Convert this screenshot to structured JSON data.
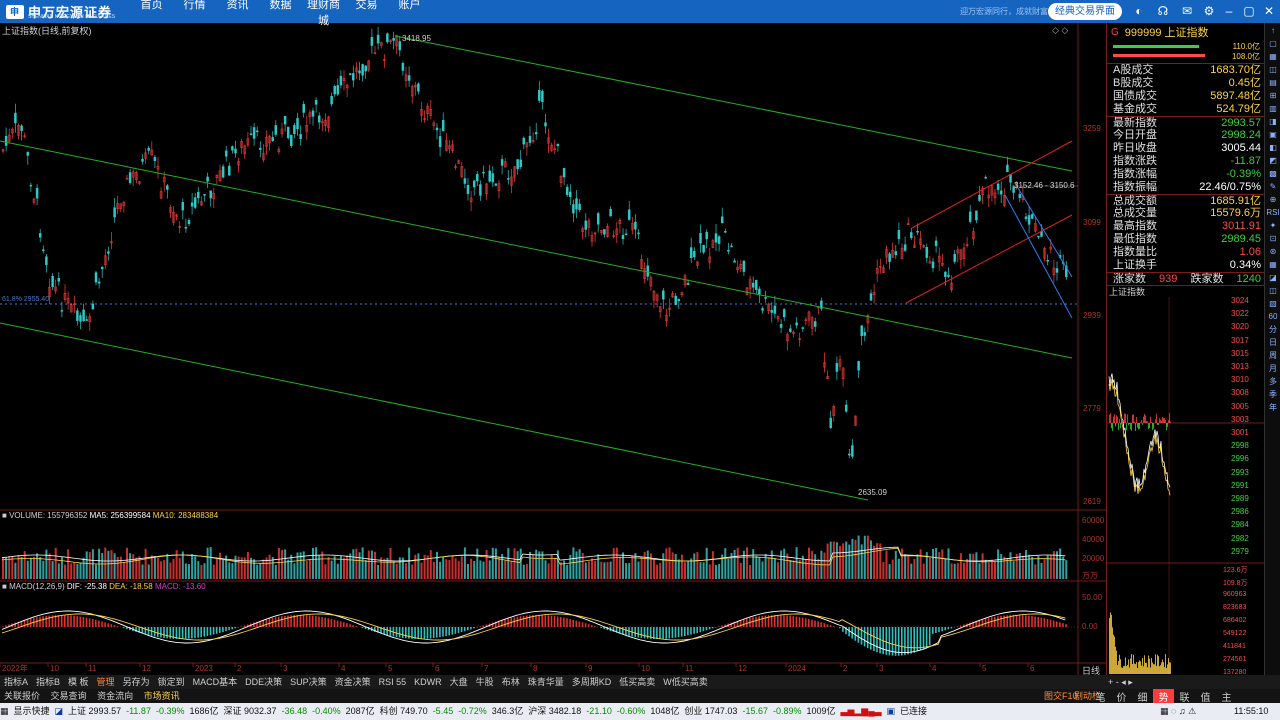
{
  "brand": {
    "name": "申万宏源证券",
    "sub": "SHENWAN HONGYUAN SECURITIES"
  },
  "nav": [
    "首页",
    "行情",
    "资讯",
    "数据",
    "理财商城",
    "交易",
    "账户"
  ],
  "slogan": "迎万宏源同行，成就财富梦想",
  "classic_button": "经典交易界面",
  "chart": {
    "title": "上证指数(日线,前复权)",
    "high_label": "3418.95",
    "low_label": "2635.09",
    "fib_label": "61.8% 2955.40",
    "channel_label": "3152.46 - 3150.6",
    "y_ticks": [
      "3259",
      "3099",
      "2939",
      "2779",
      "2619"
    ],
    "x_ticks": [
      "2022年",
      "10",
      "11",
      "12",
      "2023",
      "2",
      "3",
      "4",
      "5",
      "6",
      "7",
      "8",
      "9",
      "10",
      "11",
      "12",
      "2024",
      "2",
      "3",
      "4",
      "5",
      "6"
    ],
    "volume_legend": {
      "vol": "VOLUME: 155796352",
      "ma5": "MA5: 256399584",
      "ma10": "MA10: 283488384"
    },
    "volume_ticks": [
      "60000",
      "40000",
      "20000",
      "万万"
    ],
    "macd_legend": {
      "name": "MACD(12,26,9)",
      "dif": "DIF: -25.38",
      "dea": "DEA: -18.58",
      "macd": "MACD: -13.60"
    },
    "macd_ticks": [
      "50.00",
      "0.00"
    ]
  },
  "right_panel": {
    "code_prefix": "G",
    "code": "999999 上证指数",
    "bar_labels": [
      "110.0亿",
      "108.0亿"
    ],
    "rows": [
      {
        "label": "A股成交",
        "value": "1683.70",
        "unit": "亿",
        "color": "yellow"
      },
      {
        "label": "B股成交",
        "value": "0.45",
        "unit": "亿",
        "color": "yellow"
      },
      {
        "label": "国债成交",
        "value": "5897.48",
        "unit": "亿",
        "color": "yellow"
      },
      {
        "label": "基金成交",
        "value": "524.79",
        "unit": "亿",
        "color": "yellow"
      },
      {
        "label": "最新指数",
        "value": "2993.57",
        "unit": "",
        "color": "green"
      },
      {
        "label": "今日开盘",
        "value": "2998.24",
        "unit": "",
        "color": "green"
      },
      {
        "label": "昨日收盘",
        "value": "3005.44",
        "unit": "",
        "color": "white"
      },
      {
        "label": "指数涨跌",
        "value": "-11.87",
        "unit": "",
        "color": "green"
      },
      {
        "label": "指数涨幅",
        "value": "-0.39%",
        "unit": "",
        "color": "green"
      },
      {
        "label": "指数振幅",
        "value": "22.46/0.75%",
        "unit": "",
        "color": "white"
      },
      {
        "label": "总成交额",
        "value": "1685.91",
        "unit": "亿",
        "color": "yellow"
      },
      {
        "label": "总成交量",
        "value": "15579.6",
        "unit": "万",
        "color": "yellow"
      },
      {
        "label": "最高指数",
        "value": "3011.91",
        "unit": "",
        "color": "red"
      },
      {
        "label": "最低指数",
        "value": "2989.45",
        "unit": "",
        "color": "green"
      },
      {
        "label": "指数量比",
        "value": "1.06",
        "unit": "",
        "color": "red"
      },
      {
        "label": "上证换手",
        "value": "0.34%",
        "unit": "",
        "color": "white"
      }
    ],
    "rise_label": "涨家数",
    "rise_value": "939",
    "fall_label": "跌家数",
    "fall_value": "1240",
    "minute_title": "上证指数",
    "minute_prices": [
      "3024",
      "3022",
      "3020",
      "3017",
      "3015",
      "3013",
      "3010",
      "3008",
      "3005",
      "3003",
      "3001",
      "2998",
      "2996",
      "2993",
      "2991",
      "2989",
      "2986",
      "2984",
      "2982",
      "2979"
    ],
    "minute_volumes": [
      "123.6万",
      "109.8万",
      "960963",
      "823683",
      "686402",
      "549122",
      "411841",
      "274561",
      "137280"
    ],
    "period": "日线"
  },
  "right_tools": [
    "↑",
    "▢",
    "▦",
    "◫",
    "▤",
    "⊞",
    "▥",
    "◨",
    "▣",
    "◧",
    "◩",
    "▩",
    "✎",
    "⊕",
    "RSI",
    "✦",
    "⊡",
    "⊛",
    "▦",
    "◪",
    "◫",
    "▧",
    "60",
    "分",
    "日",
    "周",
    "月",
    "多",
    "季",
    "年"
  ],
  "tabs": [
    "指标A",
    "指标B",
    "模 板",
    "管理",
    "另存为",
    "锁定到",
    "MACD基本",
    "DDE决策",
    "SUP决策",
    "资金决策",
    "RSI 55",
    "KDWR",
    "大盘",
    "牛股",
    "布林",
    "珠青华量",
    "多周期KD",
    "低买高卖",
    "W低买高卖"
  ],
  "active_tab": "管理",
  "rtab_text": "+  -  ◂  ▸",
  "row2": [
    "关联报价",
    "交易查询",
    "资金流向",
    "市场资讯"
  ],
  "row2_right": [
    "图交F10",
    "剧动栏"
  ],
  "sub_tabs": [
    "笔",
    "价",
    "细",
    "势",
    "联",
    "值",
    "主"
  ],
  "active_sub_tab": "势",
  "status": {
    "quick": "显示快捷",
    "sh": "上证 2993.57",
    "sh_chg": "-11.87",
    "sh_pct": "-0.39%",
    "sh_amt": "1686亿",
    "sz": "深证 9032.37",
    "sz_chg": "-36.48",
    "sz_pct": "-0.40%",
    "sz_amt": "2087亿",
    "kc": "科创 749.70",
    "kc_chg": "-5.45",
    "kc_pct": "-0.72%",
    "kc_amt": "346.3亿",
    "hs": "沪深 3482.18",
    "hs_chg": "-21.10",
    "hs_pct": "-0.60%",
    "hs_amt": "1048亿",
    "cy": "创业 1747.03",
    "cy_chg": "-15.67",
    "cy_pct": "-0.89%",
    "cy_amt": "1009亿",
    "conn": "已连接",
    "time": "11:55:10"
  }
}
